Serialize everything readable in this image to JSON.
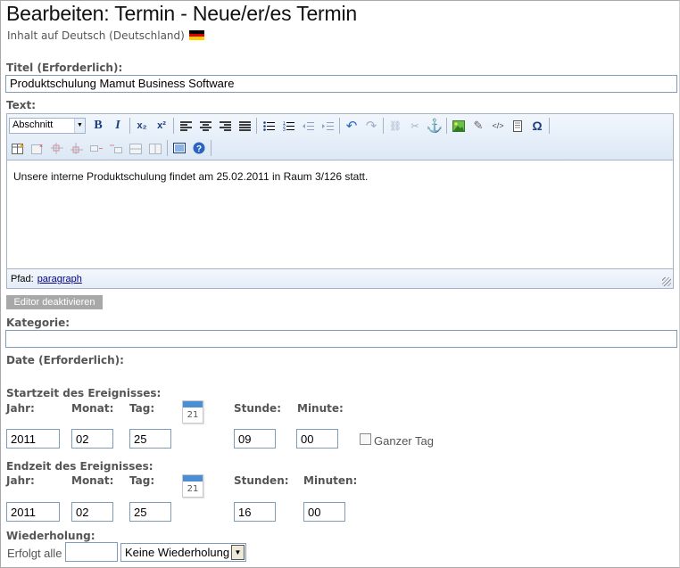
{
  "page": {
    "title": "Bearbeiten: Termin - Neue/er/es Termin",
    "language_info": "Inhalt auf Deutsch (Deutschland)"
  },
  "titel": {
    "label": "Titel (Erforderlich):",
    "value": "Produktschulung Mamut Business Software"
  },
  "text": {
    "label": "Text:",
    "format_select": "Abschnitt",
    "content": "Unsere interne Produktschulung findet am 25.02.2011 in Raum 3/126 statt.",
    "path_label": "Pfad:",
    "path_value": "paragraph",
    "toolbar_icons": {
      "bold": "B",
      "italic": "I",
      "subscript": "x₂",
      "superscript": "x²",
      "special_char": "Ω"
    }
  },
  "editor_toggle": "Editor deaktivieren",
  "kategorie": {
    "label": "Kategorie:",
    "value": ""
  },
  "date": {
    "label": "Date (Erforderlich):"
  },
  "start": {
    "heading": "Startzeit des Ereignisses:",
    "jahr_label": "Jahr:",
    "monat_label": "Monat:",
    "tag_label": "Tag:",
    "stunde_label": "Stunde:",
    "minute_label": "Minute:",
    "jahr": "2011",
    "monat": "02",
    "tag": "25",
    "stunde": "09",
    "minute": "00",
    "calendar_day": "21",
    "ganzer_tag": "Ganzer Tag"
  },
  "end": {
    "heading": "Endzeit des Ereignisses:",
    "jahr_label": "Jahr:",
    "monat_label": "Monat:",
    "tag_label": "Tag:",
    "stunden_label": "Stunden:",
    "minuten_label": "Minuten:",
    "jahr": "2011",
    "monat": "02",
    "tag": "25",
    "stunden": "16",
    "minuten": "00",
    "calendar_day": "21"
  },
  "wiederholung": {
    "label": "Wiederholung:",
    "erfolgt_label": "Erfolgt alle",
    "interval_value": "",
    "select_value": "Keine Wiederholung"
  }
}
